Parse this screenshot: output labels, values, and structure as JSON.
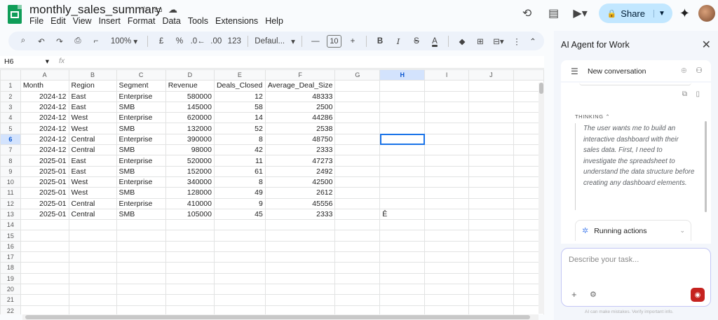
{
  "doc": {
    "title": "monthly_sales_summary",
    "menu": [
      "File",
      "Edit",
      "View",
      "Insert",
      "Format",
      "Data",
      "Tools",
      "Extensions",
      "Help"
    ],
    "share_label": "Share"
  },
  "toolbar": {
    "zoom": "100%",
    "currency": "£",
    "percent": "%",
    "number_format": "123",
    "font": "Defaul...",
    "font_size": "10",
    "bold": "B",
    "italic": "I",
    "strike": "S",
    "text_color": "A"
  },
  "formula_bar": {
    "name_box": "H6",
    "fx": "fx"
  },
  "grid": {
    "columns": [
      "A",
      "B",
      "C",
      "D",
      "E",
      "F",
      "G",
      "H",
      "I",
      "J"
    ],
    "selected_column": "H",
    "selected_row": 6,
    "header": [
      "Month",
      "Region",
      "Segment",
      "Revenue",
      "Deals_Closed",
      "Average_Deal_Size"
    ],
    "rows": [
      [
        "2024-12",
        "East",
        "Enterprise",
        "580000",
        "12",
        "48333"
      ],
      [
        "2024-12",
        "East",
        "SMB",
        "145000",
        "58",
        "2500"
      ],
      [
        "2024-12",
        "West",
        "Enterprise",
        "620000",
        "14",
        "44286"
      ],
      [
        "2024-12",
        "West",
        "SMB",
        "132000",
        "52",
        "2538"
      ],
      [
        "2024-12",
        "Central",
        "Enterprise",
        "390000",
        "8",
        "48750"
      ],
      [
        "2024-12",
        "Central",
        "SMB",
        "98000",
        "42",
        "2333"
      ],
      [
        "2025-01",
        "East",
        "Enterprise",
        "520000",
        "11",
        "47273"
      ],
      [
        "2025-01",
        "East",
        "SMB",
        "152000",
        "61",
        "2492"
      ],
      [
        "2025-01",
        "West",
        "Enterprise",
        "340000",
        "8",
        "42500"
      ],
      [
        "2025-01",
        "West",
        "SMB",
        "128000",
        "49",
        "2612"
      ],
      [
        "2025-01",
        "Central",
        "Enterprise",
        "410000",
        "9",
        "45556"
      ],
      [
        "2025-01",
        "Central",
        "SMB",
        "105000",
        "45",
        "2333"
      ]
    ],
    "h13_value": "Ê",
    "row_count": 22
  },
  "panel": {
    "title": "AI Agent for Work",
    "conversation": "New conversation",
    "thinking_label": "THINKING",
    "thinking_text": "The user wants me to build an interactive dashboard with their sales data. First, I need to investigate the spreadsheet to understand the data structure before creating any dashboard elements.",
    "running_label": "Running actions",
    "input_placeholder": "Describe your task...",
    "disclaimer": "AI can make mistakes. Verify important info."
  }
}
